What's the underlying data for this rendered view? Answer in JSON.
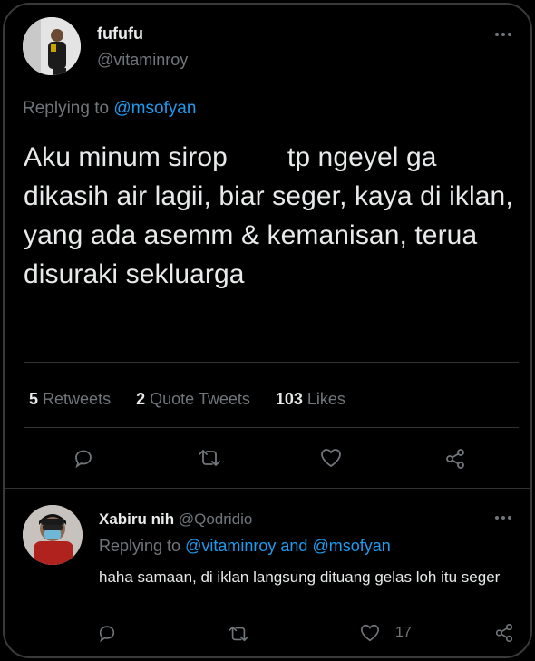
{
  "tweet": {
    "author_name": "fufufu",
    "author_handle": "@vitaminroy",
    "replying_prefix": "Replying to",
    "replying_to": "@msofyan",
    "text_line1a": "Aku minum sirop",
    "text_line1b": "tp ngeyel ga",
    "text_rest": "dikasih air lagii, biar seger, kaya di iklan, yang ada asemm & kemanisan, terua disuraki sekluarga",
    "stats": {
      "retweets_count": "5",
      "retweets_label": "Retweets",
      "quotes_count": "2",
      "quotes_label": "Quote Tweets",
      "likes_count": "103",
      "likes_label": "Likes"
    }
  },
  "reply": {
    "author_name": "Xabiru nih",
    "author_handle": "@Qodridio",
    "replying_prefix": "Replying to",
    "replying_to_1": "@vitaminroy",
    "replying_and": "and",
    "replying_to_2": "@msofyan",
    "text": "haha samaan, di iklan langsung dituang gelas loh itu seger",
    "like_count": "17"
  },
  "icons": [
    "more-icon",
    "reply-icon",
    "retweet-icon",
    "like-icon",
    "share-icon"
  ],
  "colors": {
    "background": "#000000",
    "link": "#1d9bf0",
    "muted": "#71767b",
    "text": "#e7e9ea"
  }
}
